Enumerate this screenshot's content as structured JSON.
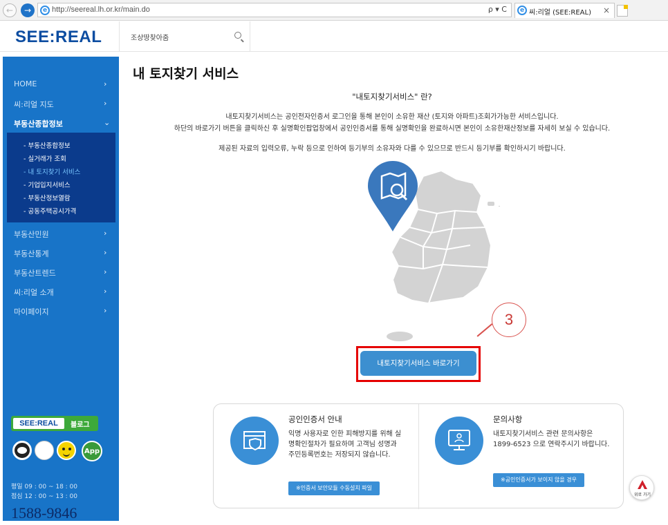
{
  "browser": {
    "url": "http://seereal.lh.or.kr/main.do",
    "tab_title": "씨:리얼 (SEE:REAL)",
    "address_tools": "ρ ▾ C"
  },
  "header": {
    "logo": "SEE:REAL",
    "search_placeholder": "조상땅찾아줌"
  },
  "sidebar": {
    "menu": [
      {
        "label": "HOME"
      },
      {
        "label": "씨:리얼 지도"
      },
      {
        "label": "부동산종합정보"
      },
      {
        "label": "부동산민원"
      },
      {
        "label": "부동산통계"
      },
      {
        "label": "부동산트렌드"
      },
      {
        "label": "씨:리얼 소개"
      },
      {
        "label": "마이페이지"
      }
    ],
    "submenu": [
      {
        "label": "- 부동산종합정보"
      },
      {
        "label": "- 실거래가 조회"
      },
      {
        "label": "- 내 토지찾기 서비스"
      },
      {
        "label": "- 기업입지서비스"
      },
      {
        "label": "- 부동산정보열람"
      },
      {
        "label": "- 공동주택공시가격"
      }
    ],
    "blog_logo": "SEE:REAL",
    "blog_label": "블로그",
    "app_label": "App",
    "hours_weekday": "평일 09 : 00 ~ 18 : 00",
    "hours_lunch": "점심 12 : 00 ~ 13 : 00",
    "phone": "1588-9846"
  },
  "main": {
    "page_title": "내 토지찾기 서비스",
    "intro_heading": "\"내토지찾기서비스\" 란?",
    "intro_line1": "내토지찾기서비스는 공인전자인증서 로그인을 통해 본인이 소유한 재산 (토지와 아파트)조회가가능한 서비스입니다.",
    "intro_line2": "하단의 바로가기 버튼을 클릭하신 후 실명확인팝업창에서 공인인증서를 통해 실명확인을 완료하시면 본인이 소유한재산정보를 자세히 보실 수 있습니다.",
    "intro_line3": "제공된 자료의 입력오류, 누락 등으로 인하여 등기부의 소유자와 다를 수 있으므로 반드시 등기부를 확인하시기 바랍니다.",
    "callout_number": "3",
    "go_button": "내토지찾기서비스 바로가기"
  },
  "info": {
    "cert_title": "공인인증서 안내",
    "cert_desc": "익명 사용자로 인한 피해방지를 위해 실명확인절차가 필요하며 고객님 성명과 주민등록번호는 저장되지 않습니다.",
    "cert_button": "※인증서 보안모듈 수동설치 파일",
    "inquiry_title": "문의사항",
    "inquiry_desc": "내토지찾기서비스 관련 문의사항은 1899-6523 으로 연락주시기 바랍니다.",
    "inquiry_button": "※공인인증서가 보이지 않을 경우"
  },
  "float": {
    "top_label": "위로 가기"
  },
  "colors": {
    "sidebar_blue": "#1874c8",
    "submenu_navy": "#0b3b8c",
    "button_blue": "#3c8fd0",
    "highlight_red": "#e50000",
    "map_gray": "#d3d3d3",
    "pin_blue": "#3a78bd"
  }
}
